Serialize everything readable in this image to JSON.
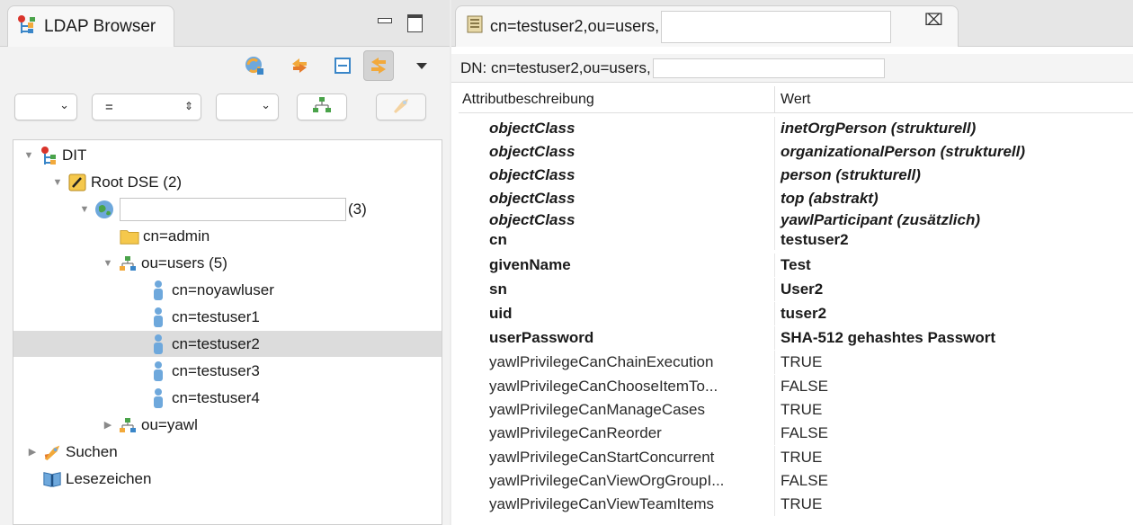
{
  "left_panel": {
    "tab_title": "LDAP Browser",
    "filter": {
      "attr_value": "",
      "operator_value": "=",
      "value_value": ""
    },
    "tree": {
      "dit": "DIT",
      "root_dse": "Root DSE (2)",
      "server_count": "(3)",
      "admin": "cn=admin",
      "users_ou": "ou=users (5)",
      "users": [
        "cn=noyawluser",
        "cn=testuser1",
        "cn=testuser2",
        "cn=testuser3",
        "cn=testuser4"
      ],
      "yawl_ou": "ou=yawl",
      "search": "Suchen",
      "bookmarks": "Lesezeichen"
    }
  },
  "editor": {
    "tab_title": "cn=testuser2,ou=users,",
    "dn_label": "DN: cn=testuser2,ou=users,",
    "columns": {
      "attribute": "Attributbeschreibung",
      "value": "Wert"
    },
    "rows": [
      {
        "attr": "objectClass",
        "value": "inetOrgPerson (strukturell)"
      },
      {
        "attr": "objectClass",
        "value": "organizationalPerson (strukturell)"
      },
      {
        "attr": "objectClass",
        "value": "person (strukturell)"
      },
      {
        "attr": "objectClass",
        "value": "top (abstrakt)"
      },
      {
        "attr": "objectClass",
        "value": "yawlParticipant (zusätzlich)"
      },
      {
        "attr": "cn",
        "value": "testuser2"
      },
      {
        "attr": "givenName",
        "value": "Test"
      },
      {
        "attr": "sn",
        "value": "User2"
      },
      {
        "attr": "uid",
        "value": "tuser2"
      },
      {
        "attr": "userPassword",
        "value": "SHA-512 gehashtes Passwort"
      },
      {
        "attr": "yawlPrivilegeCanChainExecution",
        "value": "TRUE"
      },
      {
        "attr": "yawlPrivilegeCanChooseItemTo...",
        "value": "FALSE"
      },
      {
        "attr": "yawlPrivilegeCanManageCases",
        "value": "TRUE"
      },
      {
        "attr": "yawlPrivilegeCanReorder",
        "value": "FALSE"
      },
      {
        "attr": "yawlPrivilegeCanStartConcurrent",
        "value": "TRUE"
      },
      {
        "attr": "yawlPrivilegeCanViewOrgGroupI...",
        "value": "FALSE"
      },
      {
        "attr": "yawlPrivilegeCanViewTeamItems",
        "value": "TRUE"
      }
    ]
  },
  "colors": {
    "selection": "#dcdcdc",
    "folder": "#f5c84c",
    "user_icon": "#6ea8dc",
    "ou_icon": "#4aa34a"
  }
}
